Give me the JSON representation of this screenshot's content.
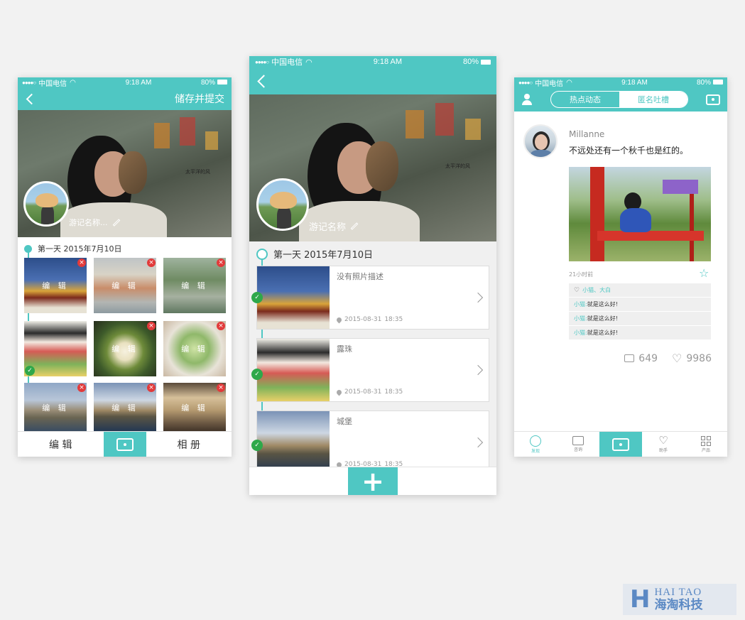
{
  "colors": {
    "teal": "#4fc7c3",
    "background": "#f2f2f2",
    "delete_red": "#e23a3a",
    "check_green": "#2ea84a"
  },
  "status": {
    "carrier": "中国电信",
    "time": "9:18 AM",
    "battery": "80%"
  },
  "screen1": {
    "header_action": "储存并提交",
    "trip_name": "游记名称...",
    "day_label": "第一天  2015年7月10日",
    "edit_caption": "编 辑",
    "thumbnails": [
      {
        "name": "palace",
        "selected": false
      },
      {
        "name": "venice",
        "selected": false
      },
      {
        "name": "garden",
        "selected": false
      },
      {
        "name": "geisha",
        "selected": true
      },
      {
        "name": "tofu",
        "selected": false
      },
      {
        "name": "melon",
        "selected": false
      },
      {
        "name": "castle",
        "selected": false
      },
      {
        "name": "castle-lake",
        "selected": false
      },
      {
        "name": "hall",
        "selected": false
      }
    ],
    "tab_edit": "编 辑",
    "tab_album": "相 册",
    "photo_signature": "太平洋的风"
  },
  "screen2": {
    "trip_name": "游记名称",
    "day_label": "第一天 2015年7月10日",
    "entries": [
      {
        "title": "没有照片描述",
        "date": "2015-08-31",
        "time": "18:35"
      },
      {
        "title": "露珠",
        "date": "2015-08-31",
        "time": "18:35"
      },
      {
        "title": "城堡",
        "date": "2015-08-31",
        "time": "18:35"
      }
    ],
    "add_symbol": "+"
  },
  "screen3": {
    "tab_hot": "热点动态",
    "tab_anon": "匿名吐槽",
    "username": "Millanne",
    "post_text": "不远处还有一个秋千也是红的。",
    "time_ago": "21小时前",
    "likers": "小猫、大白",
    "comments": [
      {
        "user": "小猫:",
        "text": "就是这么好!"
      },
      {
        "user": "小猫:",
        "text": "就是这么好!"
      },
      {
        "user": "小猫:",
        "text": "就是这么好!"
      }
    ],
    "comment_count": "649",
    "like_count": "9986",
    "nav": [
      {
        "label": "发现",
        "icon": "compass-icon",
        "active": true
      },
      {
        "label": "咨询",
        "icon": "chat-icon",
        "active": false
      },
      {
        "label": "",
        "icon": "camera-icon",
        "active": false
      },
      {
        "label": "助手",
        "icon": "heart-hands-icon",
        "active": false
      },
      {
        "label": "产品",
        "icon": "grid-icon",
        "active": false
      }
    ]
  },
  "watermark": {
    "en": "HAI TAO",
    "cn": "海淘科技",
    "letter": "H"
  }
}
